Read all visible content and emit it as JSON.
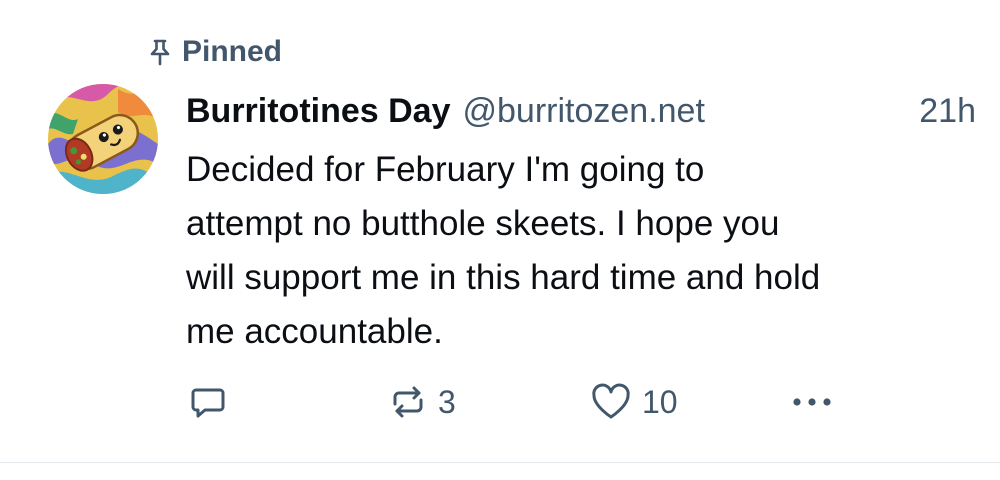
{
  "post": {
    "pinned_label": "Pinned",
    "author": {
      "display_name": "Burritotines Day",
      "handle": "@burritozen.net",
      "avatar_icon": "burrito-avatar"
    },
    "timestamp": "21h",
    "text": "Decided for February I'm going to\nattempt no butthole skeets. I hope you\nwill support me in this hard time and hold\nme accountable.",
    "actions": {
      "reply_count": "",
      "repost_count": "3",
      "like_count": "10"
    }
  },
  "colors": {
    "text_primary": "#0b0f14",
    "text_secondary": "#42576c",
    "divider": "#e3e8ed",
    "background": "#ffffff"
  }
}
